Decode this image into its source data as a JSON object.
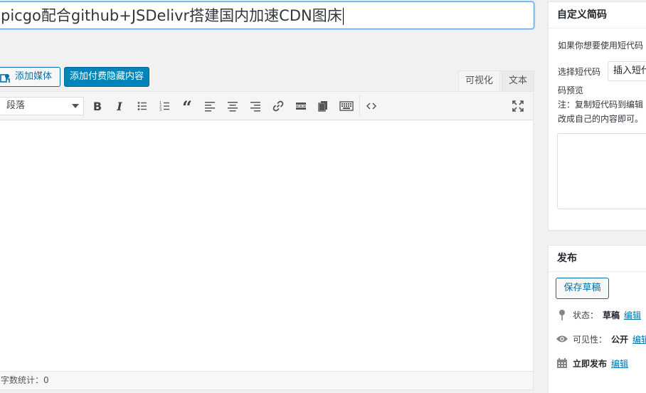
{
  "post": {
    "title": "picgo配合github+JSDelivr搭建国内加速CDN图床"
  },
  "media_buttons": {
    "add_media": "添加媒体",
    "paid_hidden": "添加付费隐藏内容"
  },
  "editor_tabs": {
    "visual": "可视化",
    "text": "文本"
  },
  "toolbar": {
    "format_value": "段落"
  },
  "status_bar": {
    "word_count": "字数统计：0"
  },
  "shortcode_panel": {
    "title": "自定义简码",
    "intro": "如果你想要使用短代码",
    "select_label": "选择短代码",
    "select_value": "插入短代",
    "preview_label": "码预览",
    "note_line1": "注：复制短代码到编辑",
    "note_line2": "改成自己的内容即可。"
  },
  "publish_panel": {
    "title": "发布",
    "save_draft": "保存草稿",
    "status_label": "状态：",
    "status_value": "草稿",
    "status_edit": "编辑",
    "visibility_label": "可见性：",
    "visibility_value": "公开",
    "visibility_edit": "编辑",
    "publish_label": "立即发布",
    "publish_edit": "编辑"
  },
  "colors": {
    "primary": "#0085ba",
    "link": "#0073aa",
    "background": "#f1f1f1"
  }
}
